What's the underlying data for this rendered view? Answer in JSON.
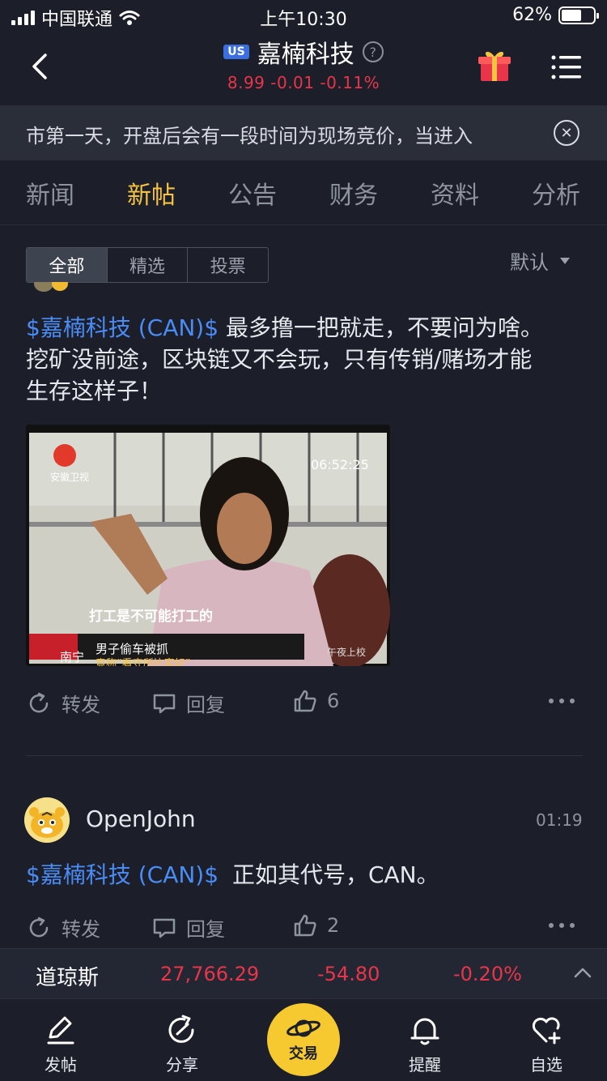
{
  "status_bar": {
    "carrier": "中国联通",
    "time": "上午10:30",
    "battery": "62%"
  },
  "header": {
    "market_badge": "US",
    "title": "嘉楠科技",
    "price": "8.99",
    "change": "-0.01",
    "change_pct": "-0.11%"
  },
  "banner": {
    "text": "市第一天，开盘后会有一段时间为现场竞价，当进入"
  },
  "tabs": [
    "新闻",
    "新帖",
    "公告",
    "财务",
    "资料",
    "分析"
  ],
  "active_tab": "新帖",
  "filter": {
    "segments": [
      "全部",
      "精选",
      "投票"
    ],
    "active": "全部",
    "sort_label": "默认"
  },
  "post1": {
    "stock_tag": "$嘉楠科技 (CAN)$",
    "line1": "最多撸一把就走，不要问为啥。",
    "line2": "挖矿没前途，区块链又不会玩，只有传销/赌场才能",
    "line3": "生存这样子！",
    "image": {
      "channel_logo_text": "安徽卫视",
      "timestamp_overlay": "06:52:25",
      "subtitle": "打工是不可能打工的",
      "location": "南宁",
      "headline": "男子偷车被抓",
      "headline2": "竟称“看守所比家好”",
      "watermark": "午夜上校"
    },
    "repost_label": "转发",
    "reply_label": "回复",
    "likes": "6"
  },
  "post2": {
    "username": "OpenJohn",
    "time": "01:19",
    "stock_tag": "$嘉楠科技 (CAN)$",
    "text": "正如其代号，CAN。",
    "repost_label": "转发",
    "reply_label": "回复",
    "likes": "2"
  },
  "ticker": {
    "name": "道琼斯",
    "value": "27,766.29",
    "change": "-54.80",
    "change_pct": "-0.20%"
  },
  "bottom_nav": {
    "post": "发帖",
    "share": "分享",
    "trade": "交易",
    "alert": "提醒",
    "watchlist": "自选"
  },
  "colors": {
    "background": "#1c1f29",
    "accent_yellow": "#f5c242",
    "down_red": "#e8354a",
    "link_blue": "#4a8cf5"
  }
}
